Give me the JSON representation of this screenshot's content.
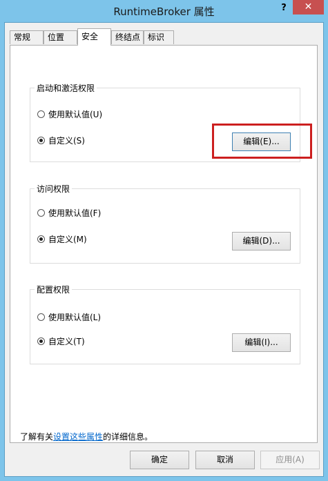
{
  "window": {
    "title": "RuntimeBroker 属性",
    "help": "?",
    "close": "✕"
  },
  "tabs": [
    {
      "label": "常规"
    },
    {
      "label": "位置"
    },
    {
      "label": "安全"
    },
    {
      "label": "终结点"
    },
    {
      "label": "标识"
    }
  ],
  "groups": {
    "launch": {
      "title": "启动和激活权限",
      "default_option": "使用默认值(U)",
      "custom_option": "自定义(S)",
      "edit_button": "编辑(E)...",
      "selected": "custom"
    },
    "access": {
      "title": "访问权限",
      "default_option": "使用默认值(F)",
      "custom_option": "自定义(M)",
      "edit_button": "编辑(D)...",
      "selected": "custom"
    },
    "config": {
      "title": "配置权限",
      "default_option": "使用默认值(L)",
      "custom_option": "自定义(T)",
      "edit_button": "编辑(I)...",
      "selected": "custom"
    }
  },
  "info": {
    "prefix": "了解有关",
    "link": "设置这些属性",
    "suffix": "的详细信息。"
  },
  "footer": {
    "ok": "确定",
    "cancel": "取消",
    "apply": "应用(A)"
  }
}
